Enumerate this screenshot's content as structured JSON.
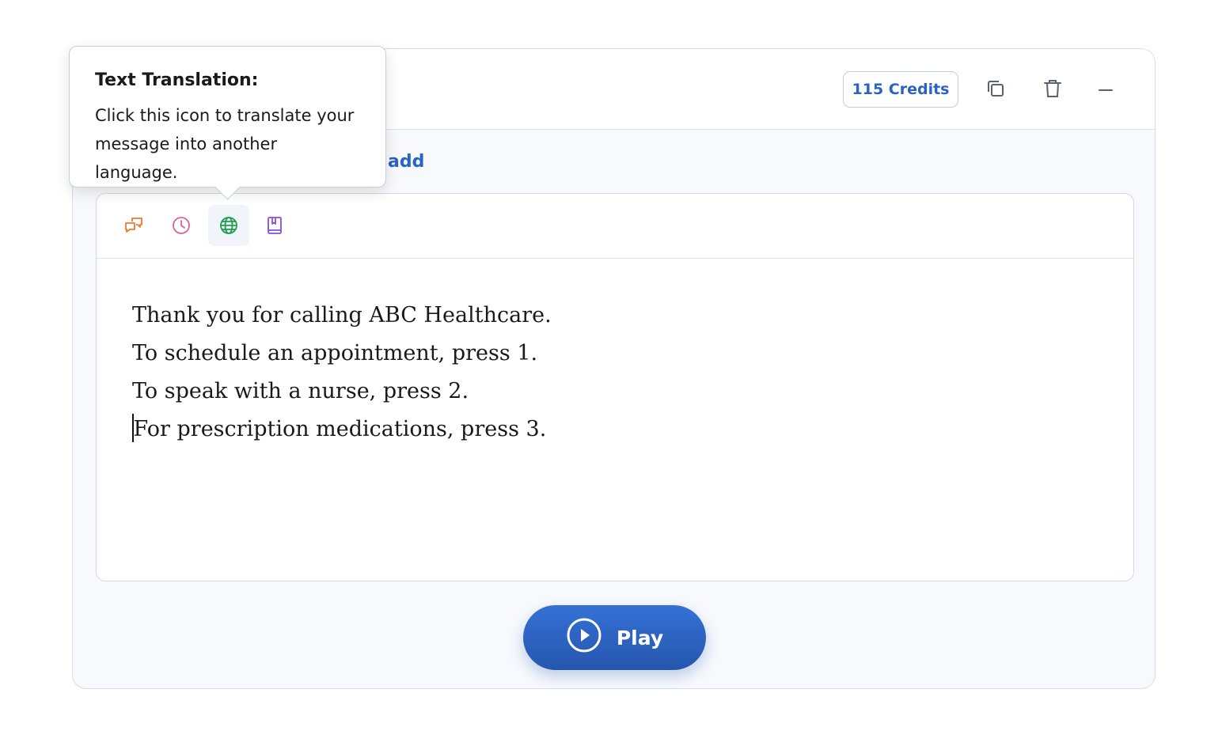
{
  "header": {
    "credits_label": "115 Credits",
    "icons": [
      "copy-icon",
      "trash-icon",
      "minimize-icon"
    ]
  },
  "subheader": {
    "link_partial": "add"
  },
  "toolbar": {
    "buttons": [
      {
        "icon": "chat-bubbles-icon",
        "color": "#ee7a2b"
      },
      {
        "icon": "clock-icon",
        "color": "#d9649a"
      },
      {
        "icon": "globe-icon",
        "color": "#1f9c4d",
        "active": true
      },
      {
        "icon": "book-icon",
        "color": "#8b4fd6"
      }
    ]
  },
  "editor": {
    "lines": [
      "Thank you for calling ABC Healthcare.",
      "To schedule an appointment, press 1.",
      "To speak with a nurse, press 2.",
      "For prescription medications, press 3."
    ]
  },
  "play_button": {
    "label": "Play",
    "color": "#2a64c2"
  },
  "tooltip": {
    "title": "Text Translation:",
    "line1": "Click this icon to translate your",
    "line2": "message into another language."
  }
}
